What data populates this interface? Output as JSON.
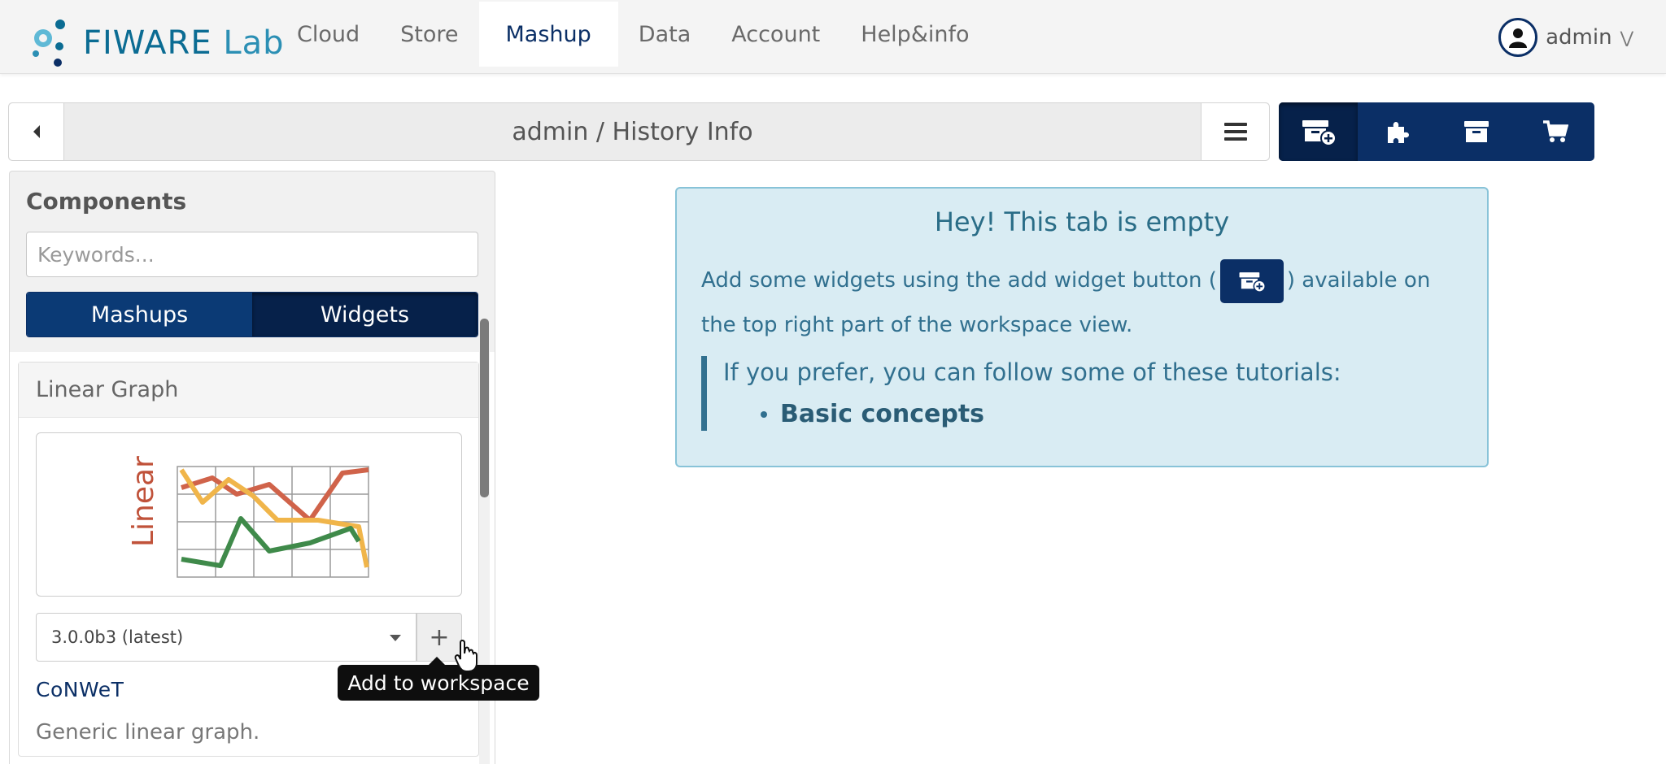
{
  "brand": {
    "logo_text_a": "FIWARE",
    "logo_text_b": "Lab",
    "colors": {
      "primary": "#0b2f66",
      "accent": "#2b8fb4"
    }
  },
  "nav": {
    "items": [
      {
        "label": "Cloud"
      },
      {
        "label": "Store"
      },
      {
        "label": "Mashup"
      },
      {
        "label": "Data"
      },
      {
        "label": "Account"
      },
      {
        "label": "Help&info"
      }
    ],
    "active": "Mashup"
  },
  "user": {
    "name": "admin",
    "icon": "user-circle-icon"
  },
  "breadcrumb": {
    "title": "admin / History Info"
  },
  "toolbar": {
    "buttons": [
      {
        "icon": "add-widget-icon",
        "active": true
      },
      {
        "icon": "puzzle-icon",
        "active": false
      },
      {
        "icon": "archive-icon",
        "active": false
      },
      {
        "icon": "cart-icon",
        "active": false
      }
    ]
  },
  "sidebar": {
    "title": "Components",
    "search_placeholder": "Keywords...",
    "toggle": {
      "mashups": "Mashups",
      "widgets": "Widgets",
      "selected": "Widgets"
    },
    "card": {
      "name": "Linear Graph",
      "thumb_label": "Linear Graph",
      "version": "3.0.0b3 (latest)",
      "add_label": "+",
      "vendor": "CoNWeT",
      "description": "Generic linear graph."
    },
    "tooltip": "Add to workspace"
  },
  "alert": {
    "title": "Hey! This tab is empty",
    "text_before": "Add some widgets using the add widget button (",
    "text_after": ") available on the top right part of the workspace view.",
    "quote": "If you prefer, you can follow some of these tutorials:",
    "tutorials": [
      "Basic concepts"
    ]
  }
}
